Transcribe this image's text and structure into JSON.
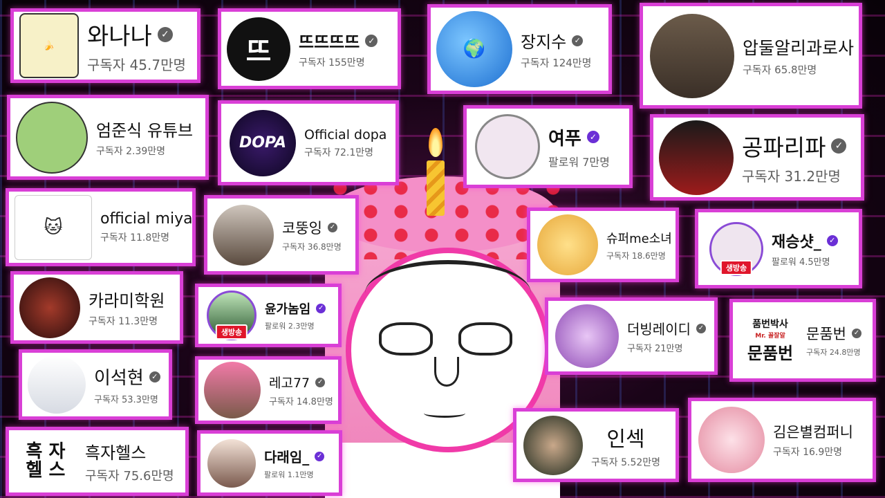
{
  "channels": {
    "wanana": {
      "name": "와나나",
      "sub": "구독자 45.7만명"
    },
    "ddddd": {
      "name": "뜨뜨뜨뜨",
      "sub": "구독자 155만명",
      "logo": "뜨"
    },
    "jangjisu": {
      "name": "장지수",
      "sub": "구독자 124만명"
    },
    "apdul": {
      "name": "압둘알리과로사",
      "sub": "구독자 65.8만명"
    },
    "eomjunsik": {
      "name": "엄준식 유튜브",
      "sub": "구독자 2.39만명"
    },
    "dopa": {
      "name": "Official dopa",
      "sub": "구독자 72.1만명",
      "logo": "DOPA"
    },
    "yeopu": {
      "name": "여푸",
      "sub": "팔로워 7만명"
    },
    "gongpa": {
      "name": "공파리파",
      "sub": "구독자 31.2만명"
    },
    "miya": {
      "name": "official miya",
      "sub": "구독자 11.8만명"
    },
    "kodungying": {
      "name": "코뚱잉",
      "sub": "구독자 36.8만명"
    },
    "superme": {
      "name": "슈퍼me소녀",
      "sub": "구독자 18.6만명"
    },
    "jaeseung": {
      "name": "재승샷_",
      "sub": "팔로워 4.5만명",
      "live": "생방송"
    },
    "karami": {
      "name": "카라미학원",
      "sub": "구독자 11.3만명"
    },
    "yungano": {
      "name": "윤가놈임",
      "sub": "팔로워 2.3만명",
      "live": "생방송"
    },
    "dubing": {
      "name": "더빙레이디",
      "sub": "구독자 21만명"
    },
    "munpumbun": {
      "name": "문품번",
      "sub": "구독자 24.8만명",
      "logo_top": "품번박사",
      "logo_mid": "Mr. 꼴잘알",
      "logo_bot": "문품번"
    },
    "leeseokhyun": {
      "name": "이석현",
      "sub": "구독자 53.3만명"
    },
    "lego77": {
      "name": "레고77",
      "sub": "구독자 14.8만명"
    },
    "insek": {
      "name": "인섹",
      "sub": "구독자 5.52만명"
    },
    "kimeunbyul": {
      "name": "김은별컴퍼니",
      "sub": "구독자 16.9만명"
    },
    "heukja": {
      "name": "흑자헬스",
      "sub": "구독자 75.6만명",
      "logo": "흑 자\n헬 스"
    },
    "daraeim": {
      "name": "다래임_",
      "sub": "팔로워 1.1만명"
    }
  },
  "check_glyph": "✓",
  "colors": {
    "frame": "#d93fd6",
    "verified": "#6b2fd6",
    "badge": "#606060",
    "live": "#e0162b"
  }
}
